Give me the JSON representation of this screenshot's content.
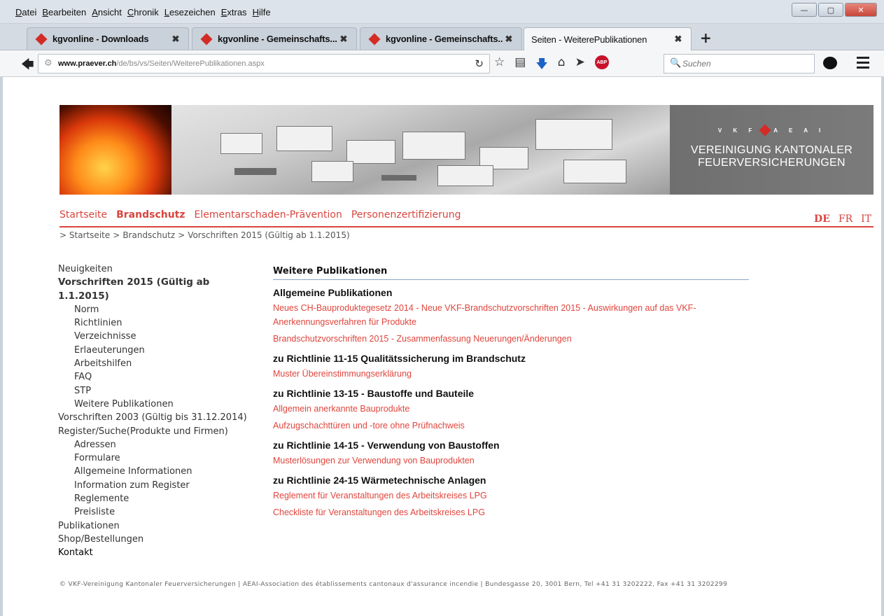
{
  "menubar": {
    "items": [
      "Datei",
      "Bearbeiten",
      "Ansicht",
      "Chronik",
      "Lesezeichen",
      "Extras",
      "Hilfe"
    ]
  },
  "tabs": [
    {
      "label": "kgvonline - Downloads"
    },
    {
      "label": "kgvonline - Gemeinschafts..."
    },
    {
      "label": "kgvonline - Gemeinschafts..."
    },
    {
      "label": "Seiten - WeiterePublikationen"
    }
  ],
  "navbar": {
    "url_host": "www.praever.ch",
    "url_path": "/de/bs/vs/Seiten/WeiterePublikationen.aspx",
    "search_placeholder": "Suchen"
  },
  "banner": {
    "logo_left": "V K F",
    "logo_right": "A E A I",
    "org_line1": "VEREINIGUNG KANTONALER",
    "org_line2": "FEUERVERSICHERUNGEN"
  },
  "mainnav": [
    "Startseite",
    "Brandschutz",
    "Elementarschaden-Prävention",
    "Personenzertifizierung"
  ],
  "languages": [
    "DE",
    "FR",
    "IT"
  ],
  "breadcrumb": [
    "> Startseite",
    ">",
    "Brandschutz",
    ">",
    "Vorschriften 2015 (Gültig ab 1.1.2015)"
  ],
  "sidenav": [
    {
      "label": "Neuigkeiten",
      "level": 0
    },
    {
      "label": "Vorschriften 2015 (Gültig ab 1.1.2015)",
      "level": 0
    },
    {
      "label": "Norm",
      "level": 1
    },
    {
      "label": "Richtlinien",
      "level": 1
    },
    {
      "label": "Verzeichnisse",
      "level": 1
    },
    {
      "label": "Erlaeuterungen",
      "level": 1
    },
    {
      "label": "Arbeitshilfen",
      "level": 1
    },
    {
      "label": "FAQ",
      "level": 1
    },
    {
      "label": "STP",
      "level": 1
    },
    {
      "label": "Weitere Publikationen",
      "level": 1
    },
    {
      "label": "Vorschriften 2003 (Gültig bis 31.12.2014)",
      "level": 0
    },
    {
      "label": "Register/Suche(Produkte und Firmen)",
      "level": 0
    },
    {
      "label": "Adressen",
      "level": 1
    },
    {
      "label": "Formulare",
      "level": 1
    },
    {
      "label": "Allgemeine Informationen",
      "level": 1
    },
    {
      "label": "Information zum Register",
      "level": 1
    },
    {
      "label": "Reglemente",
      "level": 1
    },
    {
      "label": "Preisliste",
      "level": 1
    },
    {
      "label": "Publikationen",
      "level": 0
    },
    {
      "label": "Shop/Bestellungen",
      "level": 0
    },
    {
      "label": "Kontakt",
      "level": 0
    }
  ],
  "content": {
    "title": "Weitere Publikationen",
    "sections": [
      {
        "heading": "Allgemeine Publikationen",
        "links": [
          "Neues CH-Bauproduktegesetz 2014 - Neue VKF-Brandschutzvorschriften 2015 - Auswirkungen auf das VKF-Anerkennungsverfahren für Produkte",
          "Brandschutzvorschriften 2015 - Zusammenfassung Neuerungen/Änderungen"
        ]
      },
      {
        "heading": "zu Richtlinie 11-15 Qualitätssicherung im Brandschutz",
        "links": [
          "Muster Übereinstimmungserklärung"
        ]
      },
      {
        "heading": "zu Richtlinie 13-15 - Baustoffe und Bauteile",
        "links": [
          "Allgemein anerkannte Bauprodukte",
          "Aufzugschachttüren und -tore ohne Prüfnachweis"
        ]
      },
      {
        "heading": "zu Richtlinie 14-15 - Verwendung von Baustoffen",
        "links": [
          "Musterlösungen zur Verwendung von Bauprodukten"
        ]
      },
      {
        "heading": "zu Richtlinie 24-15 Wärmetechnische Anlagen",
        "links": [
          "Reglement für Veranstaltungen des Arbeitskreises LPG",
          "Checkliste für Veranstaltungen des Arbeitskreises LPG"
        ]
      }
    ]
  },
  "footer": {
    "text": "© VKF-Vereinigung Kantonaler Feuerversicherungen | AEAI-Association des établissements cantonaux d'assurance incendie | Bundesgasse 20, 3001 Bern, Tel +41 31 3202222, Fax +41 31 3202299"
  },
  "colors": {
    "accent": "#d8453f",
    "link": "#e0453c",
    "rule": "#8aa3c8"
  }
}
